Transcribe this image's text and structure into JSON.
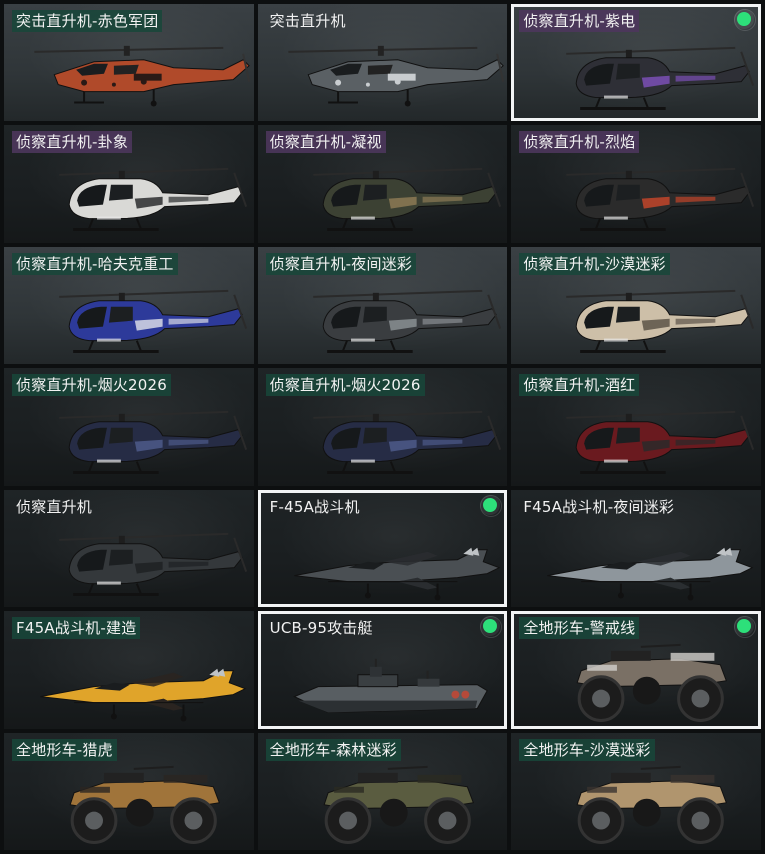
{
  "skins": [
    {
      "name": "突击直升机-赤色军团",
      "type": "attack-heli",
      "body": "#b04a2a",
      "accent": "#2a1a16",
      "bg": "light",
      "hl": "teal",
      "selected": false,
      "equipped": false
    },
    {
      "name": "突击直升机",
      "type": "attack-heli",
      "body": "#5a6064",
      "accent": "#c9cdd0",
      "bg": "light",
      "hl": "none",
      "selected": false,
      "equipped": false
    },
    {
      "name": "侦察直升机-紫电",
      "type": "scout-heli",
      "body": "#2e2f36",
      "accent": "#7a4fb5",
      "bg": "light",
      "hl": "purple",
      "selected": true,
      "equipped": true
    },
    {
      "name": "侦察直升机-卦象",
      "type": "scout-heli",
      "body": "#d9d9d6",
      "accent": "#2a2c2e",
      "bg": "dark",
      "hl": "purple",
      "selected": false,
      "equipped": false
    },
    {
      "name": "侦察直升机-凝视",
      "type": "scout-heli",
      "body": "#3c4133",
      "accent": "#8c7a55",
      "bg": "dark",
      "hl": "purple",
      "selected": false,
      "equipped": false
    },
    {
      "name": "侦察直升机-烈焰",
      "type": "scout-heli",
      "body": "#2b2b2b",
      "accent": "#c2452a",
      "bg": "dark",
      "hl": "purple",
      "selected": false,
      "equipped": false
    },
    {
      "name": "侦察直升机-哈夫克重工",
      "type": "scout-heli",
      "body": "#2d3a9a",
      "accent": "#d8dbe6",
      "bg": "light",
      "hl": "teal",
      "selected": false,
      "equipped": false
    },
    {
      "name": "侦察直升机-夜间迷彩",
      "type": "scout-heli",
      "body": "#3a3d40",
      "accent": "#8a8f93",
      "bg": "light",
      "hl": "teal",
      "selected": false,
      "equipped": false
    },
    {
      "name": "侦察直升机-沙漠迷彩",
      "type": "scout-heli",
      "body": "#cdbfa8",
      "accent": "#5c5348",
      "bg": "light",
      "hl": "teal",
      "selected": false,
      "equipped": false
    },
    {
      "name": "侦察直升机-烟火2026",
      "type": "scout-heli",
      "body": "#262c45",
      "accent": "#4d5a8a",
      "bg": "dark",
      "hl": "teal",
      "selected": false,
      "equipped": false
    },
    {
      "name": "侦察直升机-烟火2026",
      "type": "scout-heli",
      "body": "#262c45",
      "accent": "#4d5a8a",
      "bg": "dark",
      "hl": "teal",
      "selected": false,
      "equipped": false
    },
    {
      "name": "侦察直升机-酒红",
      "type": "scout-heli",
      "body": "#6a1a1f",
      "accent": "#2a2a2a",
      "bg": "dark",
      "hl": "teal",
      "selected": false,
      "equipped": false
    },
    {
      "name": "侦察直升机",
      "type": "scout-heli",
      "body": "#34383b",
      "accent": "#1e2123",
      "bg": "dark",
      "hl": "none",
      "selected": false,
      "equipped": false
    },
    {
      "name": "F-45A战斗机",
      "type": "jet",
      "body": "#4a4f53",
      "accent": "#2a2d30",
      "bg": "dark",
      "hl": "none",
      "selected": true,
      "equipped": true
    },
    {
      "name": "F45A战斗机-夜间迷彩",
      "type": "jet",
      "body": "#8e969c",
      "accent": "#2a2e31",
      "bg": "dark",
      "hl": "none",
      "selected": false,
      "equipped": false
    },
    {
      "name": "F45A战斗机-建造",
      "type": "jet",
      "body": "#e0a42a",
      "accent": "#2a2420",
      "bg": "dark",
      "hl": "teal",
      "selected": false,
      "equipped": false
    },
    {
      "name": "UCB-95攻击艇",
      "type": "boat",
      "body": "#585e62",
      "accent": "#2c3033",
      "bg": "dark",
      "hl": "none",
      "selected": true,
      "equipped": true
    },
    {
      "name": "全地形车-警戒线",
      "type": "atv",
      "body": "#7a7065",
      "accent": "#d2d0cc",
      "bg": "dark",
      "hl": "teal",
      "selected": true,
      "equipped": true
    },
    {
      "name": "全地形车-猎虎",
      "type": "atv",
      "body": "#a0743a",
      "accent": "#2a2522",
      "bg": "dark",
      "hl": "teal",
      "selected": false,
      "equipped": false
    },
    {
      "name": "全地形车-森林迷彩",
      "type": "atv",
      "body": "#5a5c40",
      "accent": "#2a2b22",
      "bg": "dark",
      "hl": "teal",
      "selected": false,
      "equipped": false
    },
    {
      "name": "全地形车-沙漠迷彩",
      "type": "atv",
      "body": "#b0956e",
      "accent": "#3a3330",
      "bg": "dark",
      "hl": "teal",
      "selected": false,
      "equipped": false
    }
  ],
  "colors": {
    "equipped_dot": "#2de07a",
    "selected_border": "#f2f4f5",
    "label_text": "#f2f2f2"
  }
}
